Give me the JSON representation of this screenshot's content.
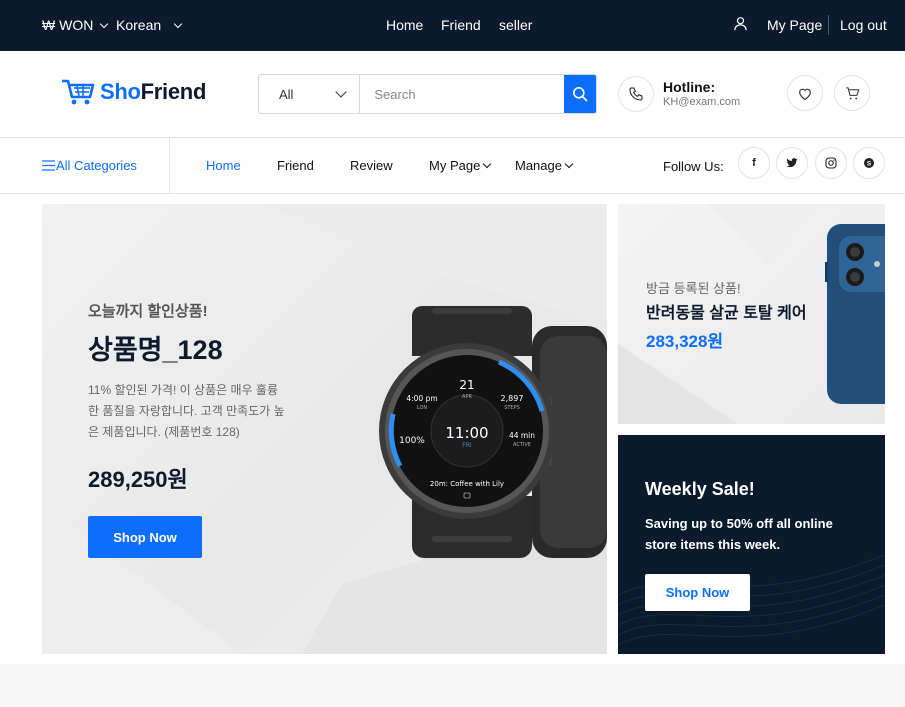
{
  "topbar": {
    "currency": "₩ WON",
    "language": "Korean",
    "nav": [
      "Home",
      "Friend",
      "seller"
    ],
    "my_page": "My Page",
    "logout": "Log out"
  },
  "header": {
    "logo_part1": "Sho",
    "logo_part2": "Friend",
    "search": {
      "category": "All",
      "placeholder": "Search"
    },
    "hotline_title": "Hotline:",
    "hotline_email": "KH@exam.com"
  },
  "nav": {
    "all_categories": "All Categories",
    "links": [
      "Home",
      "Friend",
      "Review",
      "My Page",
      "Manage"
    ],
    "follow_us": "Follow Us:",
    "social": [
      "facebook",
      "twitter",
      "instagram",
      "skype"
    ]
  },
  "hero": {
    "subtitle": "오늘까지 할인상품!",
    "title": "상품명_128",
    "description": "11% 할인된 가격! 이 상품은 매우 훌륭한 품질을 자랑합니다. 고객 만족도가 높은 제품입니다. (제품번호 128)",
    "price": "289,250원",
    "button": "Shop Now",
    "watch": {
      "time": "11:00",
      "day": "FRI",
      "date": "21",
      "month": "APR",
      "tl_time": "4:00 pm",
      "tl_label": "LON",
      "steps": "2,897",
      "steps_label": "STEPS",
      "battery": "100%",
      "active": "44 min",
      "active_label": "ACTIVE",
      "event": "20m: Coffee with Lily"
    }
  },
  "side_banner_1": {
    "subtitle": "방금 등록된 상품!",
    "title": "반려동물 살균 토탈 케어",
    "price": "283,328원"
  },
  "side_banner_2": {
    "title": "Weekly Sale!",
    "description": "Saving up to 50% off all online store items this week.",
    "button": "Shop Now"
  },
  "colors": {
    "primary": "#0d6efd",
    "dark": "#0b1a2d"
  }
}
